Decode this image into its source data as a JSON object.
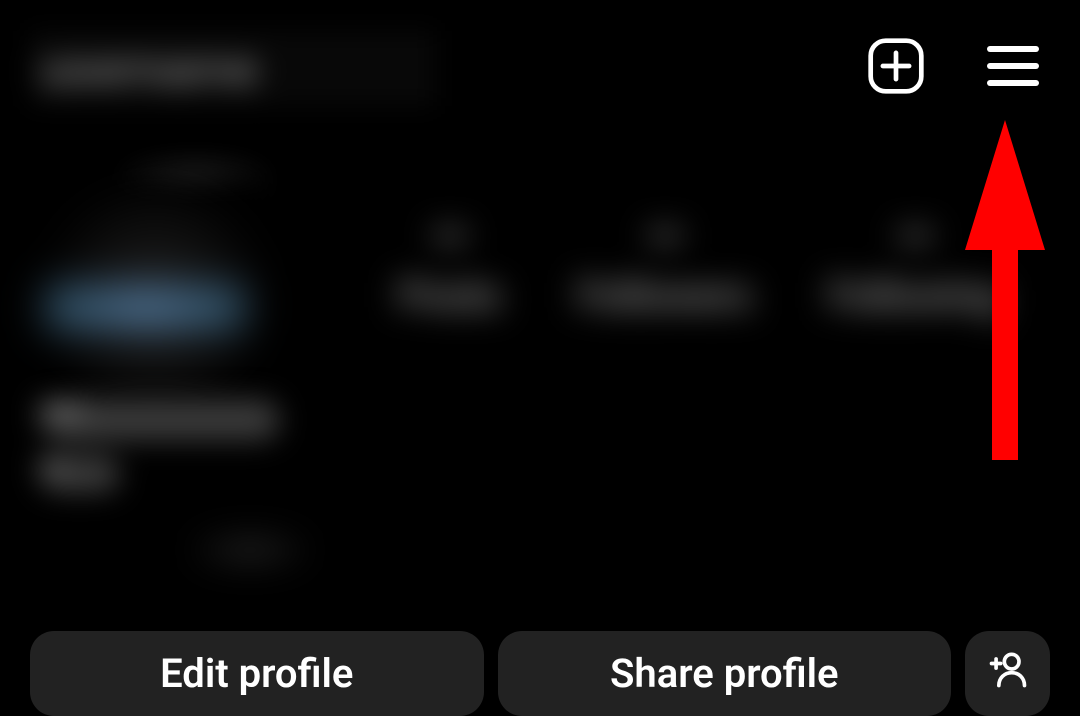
{
  "header": {
    "username": "username"
  },
  "stats": {
    "posts": {
      "count": "—",
      "label": "Posts"
    },
    "followers": {
      "count": "—",
      "label": "Followers"
    },
    "following": {
      "count": "—",
      "label": "Following"
    }
  },
  "bio": {
    "name": "Name",
    "line": "bio"
  },
  "actions": {
    "edit": "Edit profile",
    "share": "Share profile"
  },
  "annotation": {
    "arrow_color": "#ff0000",
    "points_to": "menu-button"
  }
}
